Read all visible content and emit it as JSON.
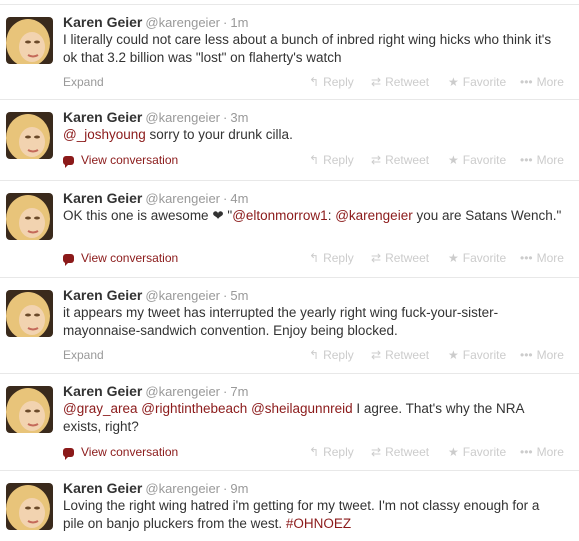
{
  "actions": {
    "reply": "Reply",
    "retweet": "Retweet",
    "favorite": "Favorite",
    "more": "More"
  },
  "icons": {
    "reply": "reply-icon",
    "retweet": "retweet-icon",
    "favorite": "star-icon",
    "more": "more-dots-icon",
    "conversation": "speech-bubble-icon"
  },
  "colors": {
    "link": "#8b1a1a",
    "muted": "#999999",
    "action": "#cccccc"
  },
  "tweets": [
    {
      "name": "Karen Geier",
      "handle": "@karengeier",
      "time": "1m",
      "segments": [
        {
          "t": "I literally could not care less about a bunch of inbred right wing hicks who think it's ok that 3.2 billion was \"lost\" on flaherty's watch"
        }
      ],
      "footer": "Expand"
    },
    {
      "name": "Karen Geier",
      "handle": "@karengeier",
      "time": "3m",
      "segments": [
        {
          "t": "@_joshyoung",
          "link": true
        },
        {
          "t": " sorry to your drunk cilla."
        }
      ],
      "footer": "View conversation"
    },
    {
      "name": "Karen Geier",
      "handle": "@karengeier",
      "time": "4m",
      "segments": [
        {
          "t": "OK this one is awesome "
        },
        {
          "t": "❤",
          "heart": true
        },
        {
          "t": " \""
        },
        {
          "t": "@eltonmorrow1",
          "link": true
        },
        {
          "t": ": "
        },
        {
          "t": "@karengeier",
          "link": true
        },
        {
          "t": " you are Satans Wench.\""
        }
      ],
      "footer": "View conversation"
    },
    {
      "name": "Karen Geier",
      "handle": "@karengeier",
      "time": "5m",
      "segments": [
        {
          "t": "it appears my tweet has interrupted the yearly right wing fuck-your-sister-mayonnaise-sandwich convention. Enjoy being blocked."
        }
      ],
      "footer": "Expand"
    },
    {
      "name": "Karen Geier",
      "handle": "@karengeier",
      "time": "7m",
      "segments": [
        {
          "t": "@gray_area",
          "link": true
        },
        {
          "t": " "
        },
        {
          "t": "@rightinthebeach",
          "link": true
        },
        {
          "t": " "
        },
        {
          "t": "@sheilagunnreid",
          "link": true
        },
        {
          "t": " I agree. That's why the NRA exists, right?"
        }
      ],
      "footer": "View conversation"
    },
    {
      "name": "Karen Geier",
      "handle": "@karengeier",
      "time": "9m",
      "segments": [
        {
          "t": "Loving the right wing hatred i'm getting for my tweet. I'm not classy enough for a pile on banjo pluckers from the west. "
        },
        {
          "t": "#OHNOEZ",
          "link": true
        }
      ],
      "footer": ""
    }
  ]
}
